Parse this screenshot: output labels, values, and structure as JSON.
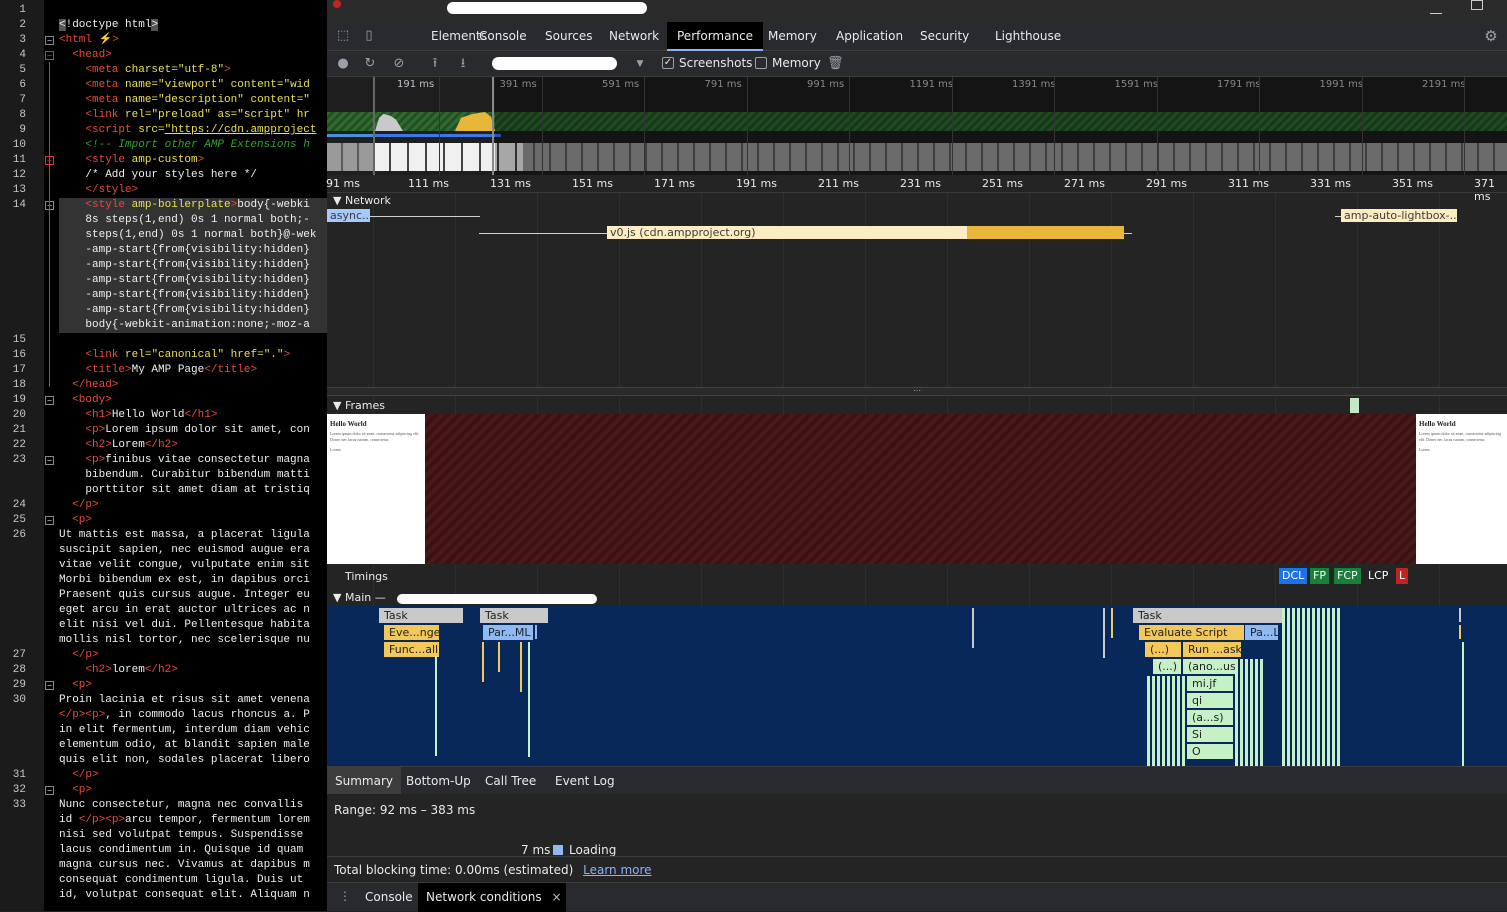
{
  "editor": {
    "lines": [
      {
        "n": "1",
        "html": ""
      },
      {
        "n": "2",
        "html": "<span style=\"background:#555\">&lt;</span>!doctype html<span style=\"background:#555\">&gt;</span>"
      },
      {
        "n": "3",
        "html": "<span class=\"tag\">&lt;html ⚡&gt;</span>"
      },
      {
        "n": "4",
        "html": "  <span class=\"tag\">&lt;head&gt;</span>"
      },
      {
        "n": "5",
        "html": "    <span class=\"tag\">&lt;meta</span> <span class=\"att\">charset=</span><span class=\"str\">\"utf-8\"</span><span class=\"tag\">&gt;</span>"
      },
      {
        "n": "6",
        "html": "    <span class=\"tag\">&lt;meta</span> <span class=\"att\">name=</span><span class=\"str\">\"viewport\"</span> <span class=\"att\">content=</span><span class=\"str\">\"wid</span>"
      },
      {
        "n": "7",
        "html": "    <span class=\"tag\">&lt;meta</span> <span class=\"att\">name=</span><span class=\"str\">\"description\"</span> <span class=\"att\">content=</span><span class=\"str\">\"</span>"
      },
      {
        "n": "8",
        "html": "    <span class=\"tag\">&lt;link</span> <span class=\"att\">rel=</span><span class=\"str\">\"preload\"</span> <span class=\"att\">as=</span><span class=\"str\">\"script\"</span> <span class=\"att\">hr</span>"
      },
      {
        "n": "9",
        "html": "    <span class=\"tag\">&lt;script</span> <span class=\"att\">src=</span><span class=\"url\">\"https://cdn.ampproject</span>"
      },
      {
        "n": "10",
        "html": "    <span class=\"cmt\">&lt;!-- Import other AMP Extensions h</span>"
      },
      {
        "n": "11",
        "html": "    <span class=\"tag\">&lt;style</span> <span class=\"att\">amp-custom</span><span class=\"tag\">&gt;</span>"
      },
      {
        "n": "12",
        "html": "    /* Add your styles here */"
      },
      {
        "n": "13",
        "html": "    <span class=\"tag\">&lt;/style&gt;</span>"
      },
      {
        "n": "14",
        "html": "    <span class=\"tag\">&lt;style</span> <span class=\"att\">amp-boilerplate</span><span class=\"tag\">&gt;</span>body{-webki"
      },
      {
        "n": "",
        "html": "    8s steps(1,end) 0s 1 normal both;-"
      },
      {
        "n": "",
        "html": "    steps(1,end) 0s 1 normal both}@-wek"
      },
      {
        "n": "",
        "html": "    -amp-start{from{visibility:hidden}"
      },
      {
        "n": "",
        "html": "    -amp-start{from{visibility:hidden}"
      },
      {
        "n": "",
        "html": "    -amp-start{from{visibility:hidden}"
      },
      {
        "n": "",
        "html": "    -amp-start{from{visibility:hidden}"
      },
      {
        "n": "",
        "html": "    -amp-start{from{visibility:hidden}"
      },
      {
        "n": "",
        "html": "    body{-webkit-animation:none;-moz-a"
      },
      {
        "n": "15",
        "html": ""
      },
      {
        "n": "16",
        "html": "    <span class=\"tag\">&lt;link</span> <span class=\"att\">rel=</span><span class=\"str\">\"canonical\"</span> <span class=\"att\">href=</span><span class=\"str\">\".\"</span><span class=\"tag\">&gt;</span>"
      },
      {
        "n": "17",
        "html": "    <span class=\"tag\">&lt;title&gt;</span>My AMP Page<span class=\"tag\">&lt;/title&gt;</span>"
      },
      {
        "n": "18",
        "html": "  <span class=\"tag\">&lt;/head&gt;</span>"
      },
      {
        "n": "19",
        "html": "  <span class=\"tag\">&lt;body&gt;</span>"
      },
      {
        "n": "20",
        "html": "    <span class=\"tag\">&lt;h1&gt;</span>Hello World<span class=\"tag\">&lt;/h1&gt;</span>"
      },
      {
        "n": "21",
        "html": "    <span class=\"tag\">&lt;p&gt;</span>Lorem ipsum dolor sit amet, con"
      },
      {
        "n": "22",
        "html": "    <span class=\"tag\">&lt;h2&gt;</span>Lorem<span class=\"tag\">&lt;/h2&gt;</span>"
      },
      {
        "n": "23",
        "html": "    <span class=\"tag\">&lt;p&gt;</span>finibus vitae consectetur magna"
      },
      {
        "n": "",
        "html": "    bibendum. Curabitur bibendum matti"
      },
      {
        "n": "",
        "html": "    porttitor sit amet diam at tristiq"
      },
      {
        "n": "24",
        "html": "  <span class=\"tag\">&lt;/p&gt;</span>"
      },
      {
        "n": "25",
        "html": "  <span class=\"tag\">&lt;p&gt;</span>"
      },
      {
        "n": "26",
        "html": "Ut mattis est massa, a placerat ligula"
      },
      {
        "n": "",
        "html": "suscipit sapien, nec euismod augue era"
      },
      {
        "n": "",
        "html": "vitae velit congue, vulputate enim sit"
      },
      {
        "n": "",
        "html": "Morbi bibendum ex est, in dapibus orci"
      },
      {
        "n": "",
        "html": "Praesent quis cursus augue. Integer eu"
      },
      {
        "n": "",
        "html": "eget arcu in erat auctor ultrices ac n"
      },
      {
        "n": "",
        "html": "elit nisi vel dui. Pellentesque habita"
      },
      {
        "n": "",
        "html": "mollis nisl tortor, nec scelerisque nu"
      },
      {
        "n": "27",
        "html": "  <span class=\"tag\">&lt;/p&gt;</span>"
      },
      {
        "n": "28",
        "html": "    <span class=\"tag\">&lt;h2&gt;</span>lorem<span class=\"tag\">&lt;/h2&gt;</span>"
      },
      {
        "n": "29",
        "html": "  <span class=\"tag\">&lt;p&gt;</span>"
      },
      {
        "n": "30",
        "html": "Proin lacinia et risus sit amet venena"
      },
      {
        "n": "",
        "html": "<span class=\"tag\">&lt;/p&gt;&lt;p&gt;</span>, in commodo lacus rhoncus a. P"
      },
      {
        "n": "",
        "html": "in elit fermentum, interdum diam vehic"
      },
      {
        "n": "",
        "html": "elementum odio, at blandit sapien male"
      },
      {
        "n": "",
        "html": "quis elit non, sodales placerat libero"
      },
      {
        "n": "31",
        "html": "  <span class=\"tag\">&lt;/p&gt;</span>"
      },
      {
        "n": "32",
        "html": "  <span class=\"tag\">&lt;p&gt;</span>"
      },
      {
        "n": "33",
        "html": "Nunc consectetur, magna nec convallis"
      },
      {
        "n": "",
        "html": "id <span class=\"tag\">&lt;/p&gt;&lt;p&gt;</span>arcu tempor, fermentum lorem"
      },
      {
        "n": "",
        "html": "nisi sed volutpat tempus. Suspendisse"
      },
      {
        "n": "",
        "html": "lacus condimentum in. Quisque id quam"
      },
      {
        "n": "",
        "html": "magna cursus nec. Vivamus at dapibus m"
      },
      {
        "n": "",
        "html": "consequat condimentum ligula. Duis ut"
      },
      {
        "n": "",
        "html": "id, volutpat consequat elit. Aliquam n"
      }
    ]
  },
  "devtools": {
    "tabs": [
      "Elements",
      "Console",
      "Sources",
      "Network",
      "Performance",
      "Memory",
      "Application",
      "Security",
      "Lighthouse"
    ],
    "active_tab": "Performance",
    "controls": {
      "screenshots_label": "Screenshots",
      "memory_label": "Memory"
    },
    "overview_ticks": [
      "191 ms",
      "391 ms",
      "591 ms",
      "791 ms",
      "991 ms",
      "1191 ms",
      "1391 ms",
      "1591 ms",
      "1791 ms",
      "1991 ms",
      "2191 ms"
    ],
    "ruler_ticks": [
      "91 ms",
      "111 ms",
      "131 ms",
      "151 ms",
      "171 ms",
      "191 ms",
      "211 ms",
      "231 ms",
      "251 ms",
      "271 ms",
      "291 ms",
      "311 ms",
      "331 ms",
      "351 ms",
      "371 ms"
    ],
    "sections": {
      "network": "Network",
      "frames": "Frames",
      "timings": "Timings",
      "main": "Main —"
    },
    "network_requests": [
      "async...",
      "v0.js (cdn.ampproject.org)",
      "amp-auto-lightbox-..."
    ],
    "timing_markers": [
      {
        "label": "DCL",
        "color": "#1a73e8"
      },
      {
        "label": "FP",
        "color": "#188038"
      },
      {
        "label": "FCP",
        "color": "#188038"
      },
      {
        "label": "LCP",
        "color": "#137333"
      },
      {
        "label": "L",
        "color": "#c5221f"
      }
    ],
    "frame_preview": {
      "heading": "Hello World",
      "text": "Lorem ipsum dolor sit amet, consectetur adipiscing elit. Donec nec lacus rutrum, consectetur.",
      "subheading": "Lorem"
    },
    "flame": {
      "task1": "Task",
      "task2": "Task",
      "task3": "Task",
      "evt": "Eve...nge",
      "func": "Func...all",
      "parse": "Par...ML",
      "eval": "Evaluate Script",
      "pa": "Pa...L",
      "anon1": "(...)",
      "run": "Run ...asks",
      "anon2": "(...)",
      "anon3": "(ano...us)",
      "mjf": "mi.jf",
      "qi": "qi",
      "as": "(a...s)",
      "si": "Si",
      "o": "O"
    },
    "bottom_tabs": [
      "Summary",
      "Bottom-Up",
      "Call Tree",
      "Event Log"
    ],
    "summary": {
      "range": "Range: 92 ms – 383 ms",
      "loading_value": "7 ms",
      "loading_label": "Loading"
    },
    "blocking": {
      "text": "Total blocking time: 0.00ms (estimated)",
      "link": "Learn more"
    },
    "drawer": {
      "console": "Console",
      "network_conditions": "Network conditions",
      "close": "×"
    }
  }
}
